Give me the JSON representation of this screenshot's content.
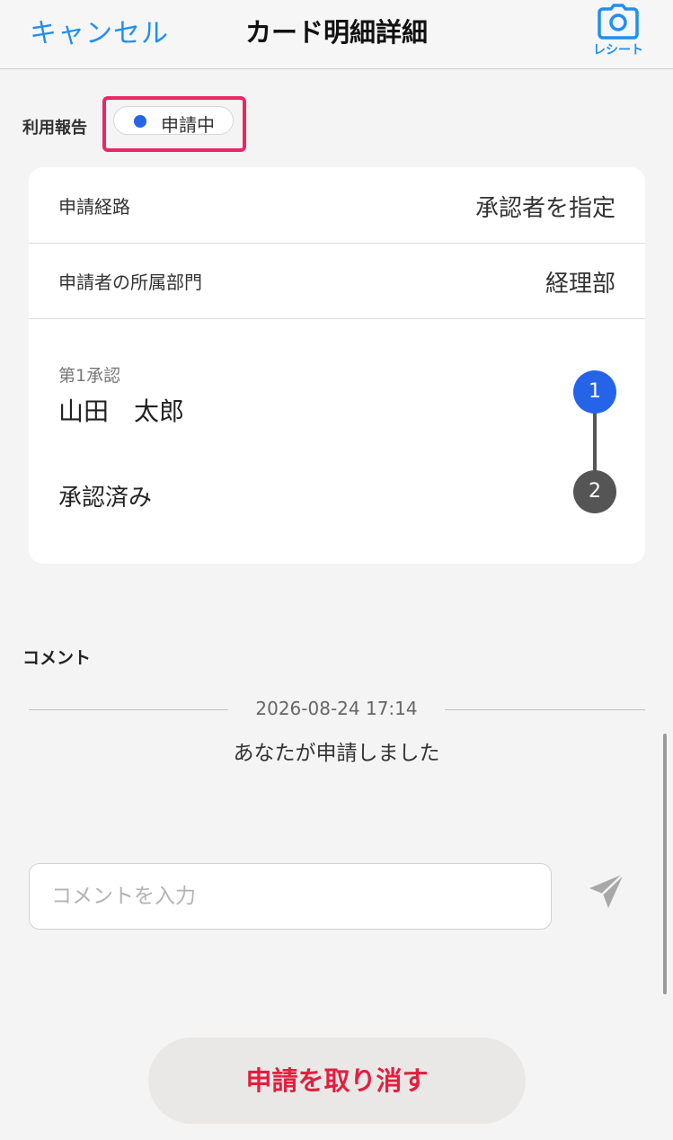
{
  "header": {
    "cancel_label": "キャンセル",
    "title": "カード明細詳細",
    "receipt_label": "レシート",
    "receipt_icon": "camera-icon"
  },
  "status": {
    "label": "利用報告",
    "badge": "申請中",
    "dot_color": "#2563e9"
  },
  "details": {
    "route_label": "申請経路",
    "route_value": "承認者を指定",
    "dept_label": "申請者の所属部門",
    "dept_value": "経理部"
  },
  "approval": {
    "step1_sub": "第1承認",
    "step1_name": "山田　太郎",
    "step1_number": "1",
    "step2_label": "承認済み",
    "step2_number": "2"
  },
  "comments": {
    "heading": "コメント",
    "timestamp": "2026-08-24 17:14",
    "message": "あなたが申請しました",
    "input_placeholder": "コメントを入力",
    "send_icon": "send-icon"
  },
  "footer": {
    "cancel_request_label": "申請を取り消す"
  },
  "colors": {
    "accent": "#1f8ff0",
    "danger": "#e41e3f",
    "highlight": "#ec2566"
  }
}
